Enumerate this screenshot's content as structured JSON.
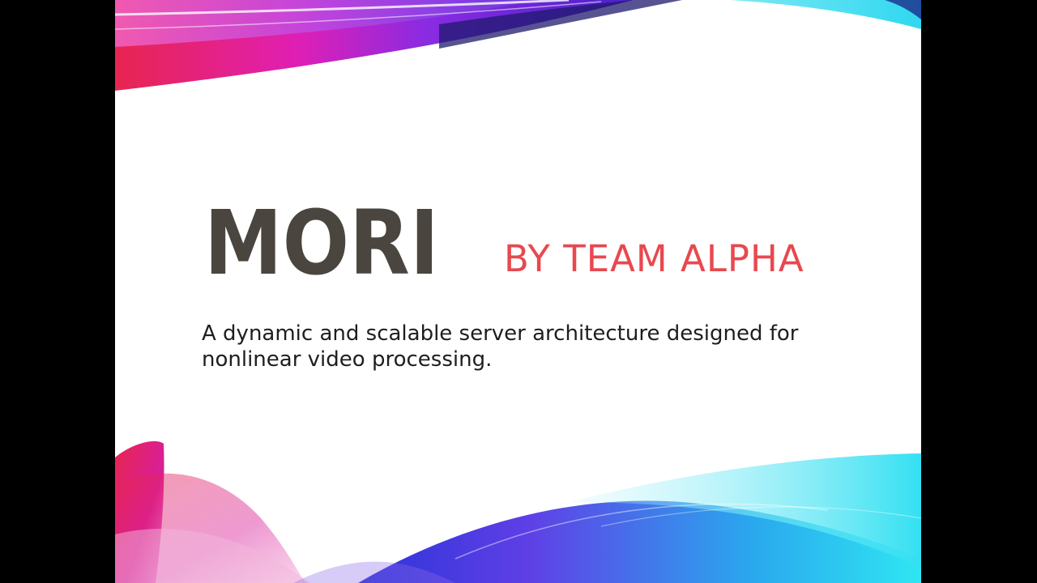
{
  "slide": {
    "logo_text": "MORI",
    "subtitle": "BY TEAM ALPHA",
    "tagline": "A dynamic and scalable server architecture designed for nonlinear video processing."
  },
  "colors": {
    "logo": "#4a463f",
    "subtitle": "#e8484f",
    "text": "#1e1e1e",
    "slide_background": "#ffffff",
    "frame_background": "#000000",
    "magenta": "#e01fb4",
    "red": "#e8254f",
    "purple": "#7a2ee6",
    "blue": "#2a35d8",
    "cyan": "#2fdff0"
  },
  "icons": [
    "mori-logo",
    "ribbon-decoration"
  ]
}
